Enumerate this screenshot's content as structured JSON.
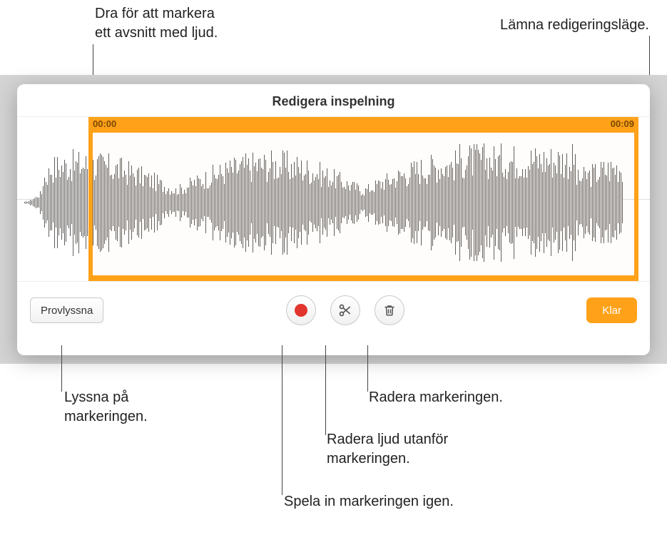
{
  "callouts": {
    "selection": "Dra för att markera\nett avsnitt med ljud.",
    "done": "Lämna redigeringsläge.",
    "preview": "Lyssna på\nmarkeringen.",
    "delete": "Radera markeringen.",
    "trim": "Radera ljud utanför\nmarkeringen.",
    "record": "Spela in markeringen igen."
  },
  "panel": {
    "title": "Redigera inspelning",
    "time_start": "00:00",
    "time_end": "00:09"
  },
  "toolbar": {
    "preview": "Provlyssna",
    "done": "Klar"
  },
  "icons": {
    "record": "record-icon",
    "trim": "scissors-icon",
    "delete": "trash-icon"
  },
  "colors": {
    "accent": "#ffa21a",
    "record": "#e1352e"
  }
}
